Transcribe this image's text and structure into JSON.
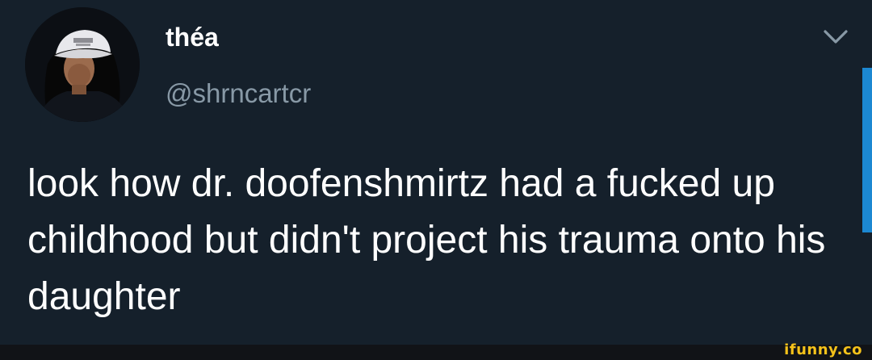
{
  "tweet": {
    "display_name": "théa",
    "handle": "@shrncartcr",
    "text": "look how dr. doofenshmirtz had a fucked up childhood but didn't project his trauma onto his daughter",
    "menu_icon": "chevron-down-icon",
    "avatar_icon": "profile-photo"
  },
  "watermark": {
    "text": "ifunny.co"
  },
  "colors": {
    "background": "#15202b",
    "name": "#ffffff",
    "handle": "#8899a6",
    "accent": "#1d9bf0",
    "watermark": "#f5c21a"
  }
}
